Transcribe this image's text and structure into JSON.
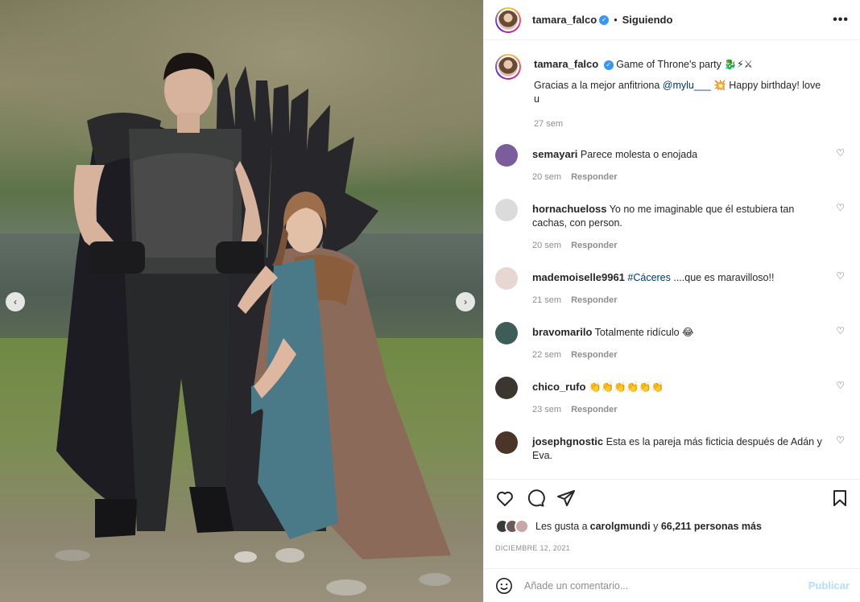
{
  "post": {
    "username": "tamara_falco",
    "follow_status": "Siguiendo",
    "dot": "•",
    "more": "•••",
    "caption_text": "Game of Throne's party 🐉⚡⚔",
    "caption_line2_pre": "Gracias a la mejor anfitriona ",
    "caption_mention": "@mylu___",
    "caption_line2_post": " 💥 Happy birthday! love u",
    "caption_time": "27 sem"
  },
  "comments": [
    {
      "user": "semayari",
      "text": "Parece molesta o enojada",
      "time": "20 sem",
      "reply": "Responder",
      "avatar_color": "#7b5c9c"
    },
    {
      "user": "hornachueloss",
      "text": "Yo no me imaginable que él estubiera tan cachas, con person.",
      "time": "20 sem",
      "reply": "Responder",
      "avatar_color": "#dbdbdb"
    },
    {
      "user": "mademoiselle9961",
      "tag": "#Cáceres",
      "text": " ....que es maravilloso!!",
      "time": "21 sem",
      "reply": "Responder",
      "avatar_color": "#e7d6d2"
    },
    {
      "user": "bravomarilo",
      "text": "Totalmente ridículo 😂",
      "time": "22 sem",
      "reply": "Responder",
      "avatar_color": "#3f5d58"
    },
    {
      "user": "chico_rufo",
      "text": "👏👏👏👏👏👏",
      "time": "23 sem",
      "reply": "Responder",
      "avatar_color": "#3b3630"
    },
    {
      "user": "josephgnostic",
      "text": "Esta es la pareja más ficticia después de Adán y Eva.",
      "time": "",
      "reply": "",
      "avatar_color": "#4a3528"
    }
  ],
  "likes": {
    "pre": "Les gusta a ",
    "user": "carolgmundi",
    "mid": " y ",
    "count": "66,211 personas más"
  },
  "date": "DICIEMBRE 12, 2021",
  "add_comment": {
    "placeholder": "Añade un comentario...",
    "publish": "Publicar"
  },
  "icons": {
    "more": "more-horizontal-icon",
    "like": "heart-icon",
    "comment": "comment-icon",
    "share": "share-icon",
    "save": "bookmark-icon",
    "emoji": "emoji-icon",
    "prev": "chevron-left-icon",
    "next": "chevron-right-icon"
  },
  "colors": {
    "accent": "#3897f0",
    "link": "#00376b",
    "muted": "#8e8e8e",
    "publish": "#b2dffc"
  }
}
